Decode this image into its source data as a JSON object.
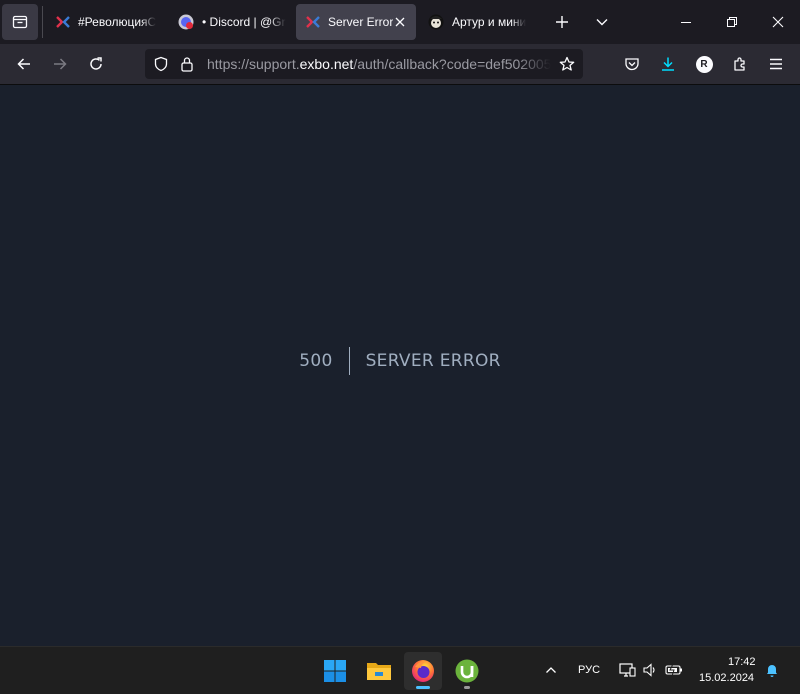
{
  "tabs": [
    {
      "title": "#РеволюцияС",
      "icon": "exbo-logo-icon",
      "active": false
    },
    {
      "title": "• Discord | @Gr",
      "icon": "discord-avatar-icon",
      "active": false
    },
    {
      "title": "Server Error",
      "icon": "exbo-logo-icon",
      "active": true
    },
    {
      "title": "Артур и мини",
      "icon": "avatar-icon",
      "active": false
    }
  ],
  "url": {
    "prefix": "https://support.",
    "host": "exbo.net",
    "path": "/auth/callback?code=def502005"
  },
  "page": {
    "code": "500",
    "message": "Server Error"
  },
  "tray": {
    "language": "РУС",
    "time": "17:42",
    "date": "15.02.2024"
  },
  "profile_initial": "R",
  "colors": {
    "page_bg": "#1a202c",
    "error_text": "#a0aec0",
    "accent": "#00ddff"
  }
}
